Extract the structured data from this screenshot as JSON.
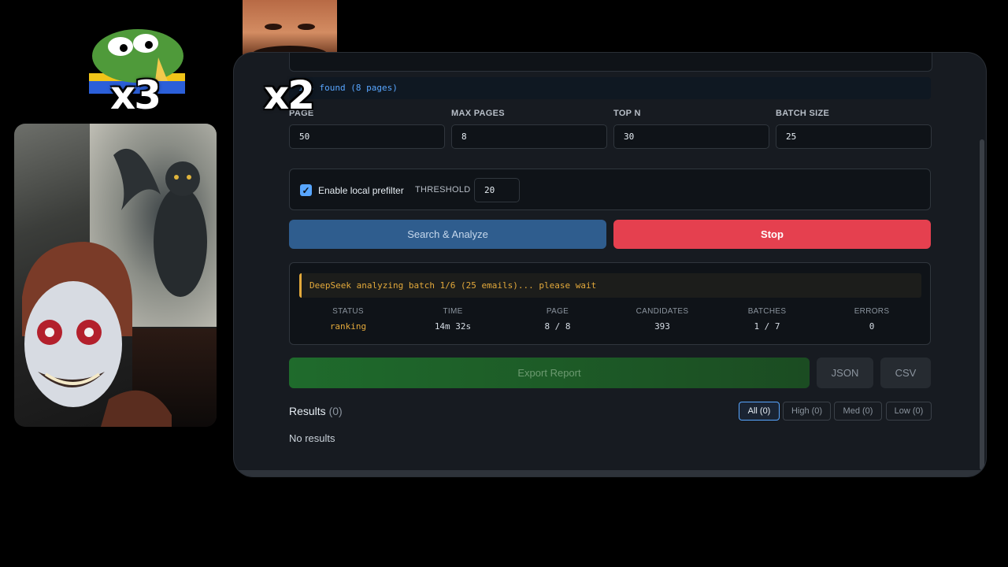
{
  "overlay": {
    "emote_left_multiplier": "x3",
    "emote_right_multiplier": "x2"
  },
  "log": {
    "line": "ils found (8 pages)"
  },
  "fields": [
    {
      "label": "PAGE",
      "value": "50"
    },
    {
      "label": "MAX PAGES",
      "value": "8"
    },
    {
      "label": "TOP N",
      "value": "30"
    },
    {
      "label": "BATCH SIZE",
      "value": "25"
    }
  ],
  "prefilter": {
    "label": "Enable local prefilter",
    "checked": true,
    "threshold_label": "THRESHOLD",
    "threshold_value": "20"
  },
  "actions": {
    "analyze_label": "Search & Analyze",
    "stop_label": "Stop"
  },
  "status": {
    "message": "DeepSeek analyzing batch 1/6 (25 emails)... please wait",
    "stats": [
      {
        "label": "STATUS",
        "value": "ranking"
      },
      {
        "label": "TIME",
        "value": "14m 32s"
      },
      {
        "label": "PAGE",
        "value": "8 / 8"
      },
      {
        "label": "CANDIDATES",
        "value": "393"
      },
      {
        "label": "BATCHES",
        "value": "1 / 7"
      },
      {
        "label": "ERRORS",
        "value": "0"
      }
    ]
  },
  "export": {
    "report_label": "Export Report",
    "json_label": "JSON",
    "csv_label": "CSV"
  },
  "results": {
    "title": "Results",
    "count": "(0)",
    "filters": [
      "All (0)",
      "High (0)",
      "Med (0)",
      "Low (0)"
    ],
    "empty_text": "No results"
  },
  "colors": {
    "accent": "#58a6ff",
    "stop": "#e5404f",
    "warning": "#e3a93b",
    "export": "#1f6b2c"
  }
}
